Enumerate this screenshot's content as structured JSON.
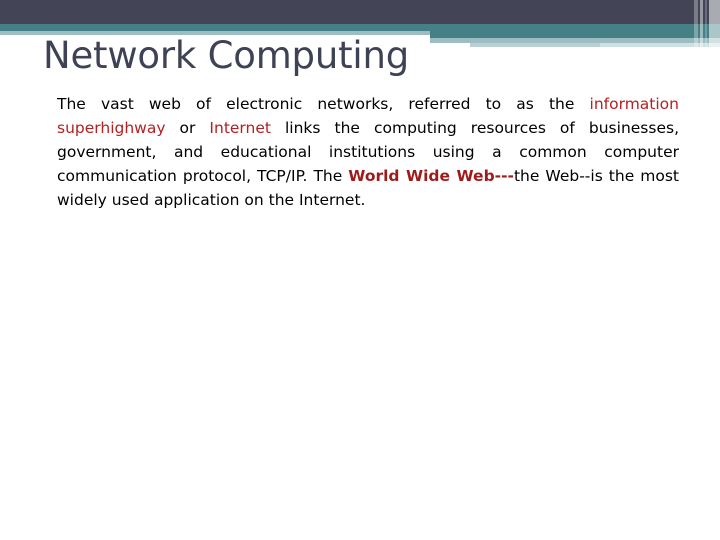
{
  "slide": {
    "title": "Network Computing",
    "accent_colors": {
      "dark_navy": "#434455",
      "teal": "#468087",
      "pale_blue": "#9dbdc2",
      "light_blue": "#b9d0d4",
      "title_text": "#3d4254",
      "highlight_red": "#b52020",
      "highlight_red_bold": "#9e1b1b",
      "body_text": "#000000",
      "background": "#ffffff"
    },
    "body": {
      "full_text": "The vast web of electronic networks, referred to as the information superhighway or Internet links the computing resources of businesses, government, and educational institutions using a common computer communication protocol, TCP/IP. The World Wide Web---the Web--is the most widely used application on the Internet.",
      "runs": [
        {
          "text": "The vast web of electronic networks, referred to as the ",
          "style": "normal"
        },
        {
          "text": "information superhighway",
          "style": "highlight"
        },
        {
          "text": " or ",
          "style": "normal"
        },
        {
          "text": "Internet",
          "style": "highlight"
        },
        {
          "text": " links the computing resources of businesses, government, and educational institutions using a common computer communication protocol, TCP/IP. The ",
          "style": "normal"
        },
        {
          "text": "World Wide Web---",
          "style": "highlight-bold"
        },
        {
          "text": "the Web--is the most widely used application on the Internet.",
          "style": "normal"
        }
      ]
    }
  }
}
